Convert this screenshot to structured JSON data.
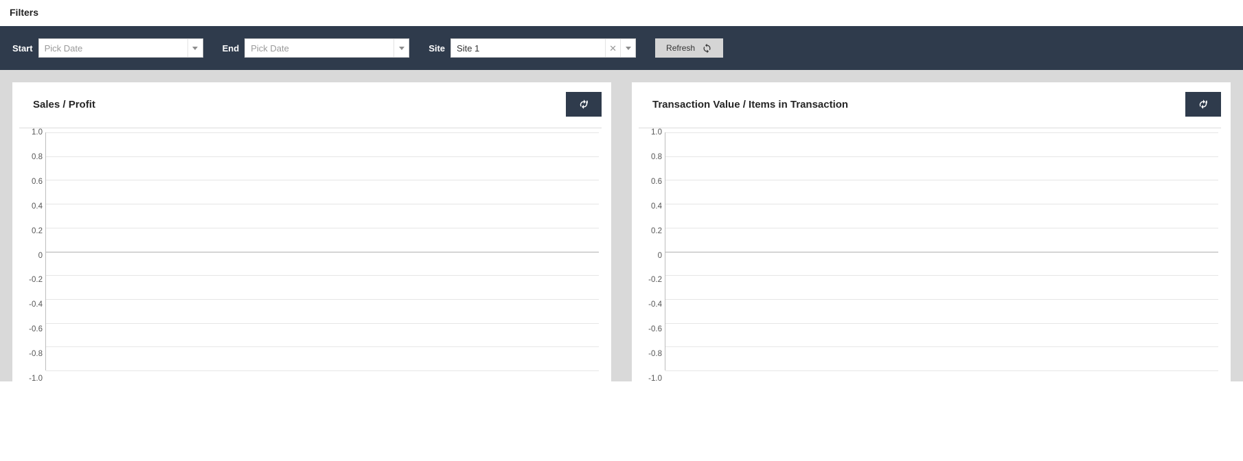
{
  "heading": "Filters",
  "filters": {
    "start": {
      "label": "Start",
      "placeholder": "Pick Date",
      "value": ""
    },
    "end": {
      "label": "End",
      "placeholder": "Pick Date",
      "value": ""
    },
    "site": {
      "label": "Site",
      "value": "Site 1"
    },
    "refresh_label": "Refresh"
  },
  "cards": {
    "left": {
      "title": "Sales / Profit"
    },
    "right": {
      "title": "Transaction Value / Items in Transaction"
    }
  },
  "chart_data": [
    {
      "type": "line",
      "title": "Sales / Profit",
      "ylim": [
        -1.0,
        1.0
      ],
      "yticks": [
        1.0,
        0.8,
        0.6,
        0.4,
        0.2,
        0,
        -0.2,
        -0.4,
        -0.6,
        -0.8,
        -1.0
      ],
      "series": []
    },
    {
      "type": "line",
      "title": "Transaction Value / Items in Transaction",
      "ylim": [
        -1.0,
        1.0
      ],
      "yticks": [
        1.0,
        0.8,
        0.6,
        0.4,
        0.2,
        0,
        -0.2,
        -0.4,
        -0.6,
        -0.8,
        -1.0
      ],
      "series": []
    }
  ]
}
